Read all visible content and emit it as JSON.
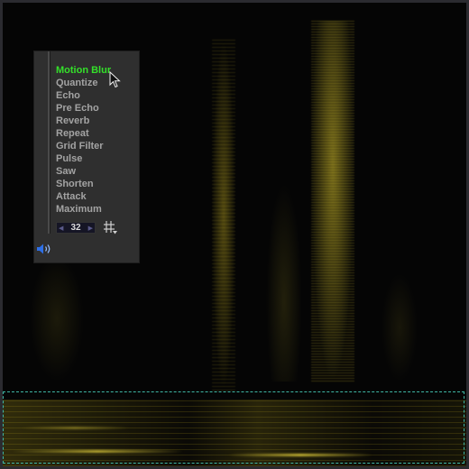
{
  "menu": {
    "items": [
      {
        "label": "Motion Blur",
        "active": true
      },
      {
        "label": "Quantize",
        "active": false
      },
      {
        "label": "Echo",
        "active": false
      },
      {
        "label": "Pre Echo",
        "active": false
      },
      {
        "label": "Reverb",
        "active": false
      },
      {
        "label": "Repeat",
        "active": false
      },
      {
        "label": "Grid Filter",
        "active": false
      },
      {
        "label": "Pulse",
        "active": false
      },
      {
        "label": "Saw",
        "active": false
      },
      {
        "label": "Shorten",
        "active": false
      },
      {
        "label": "Attack",
        "active": false
      },
      {
        "label": "Maximum",
        "active": false
      }
    ]
  },
  "stepper": {
    "value": "32"
  },
  "icons": {
    "grid": "grid-icon",
    "speaker": "speaker-icon",
    "cursor": "cursor-icon",
    "left_arrow": "left-arrow-icon",
    "right_arrow": "right-arrow-icon"
  },
  "colors": {
    "active_item": "#34e02a",
    "inactive_item": "#a3a3a3",
    "selection_border": "#3fb7a5",
    "spectrogram": "#d6c232",
    "speaker": "#2e6fe6"
  }
}
